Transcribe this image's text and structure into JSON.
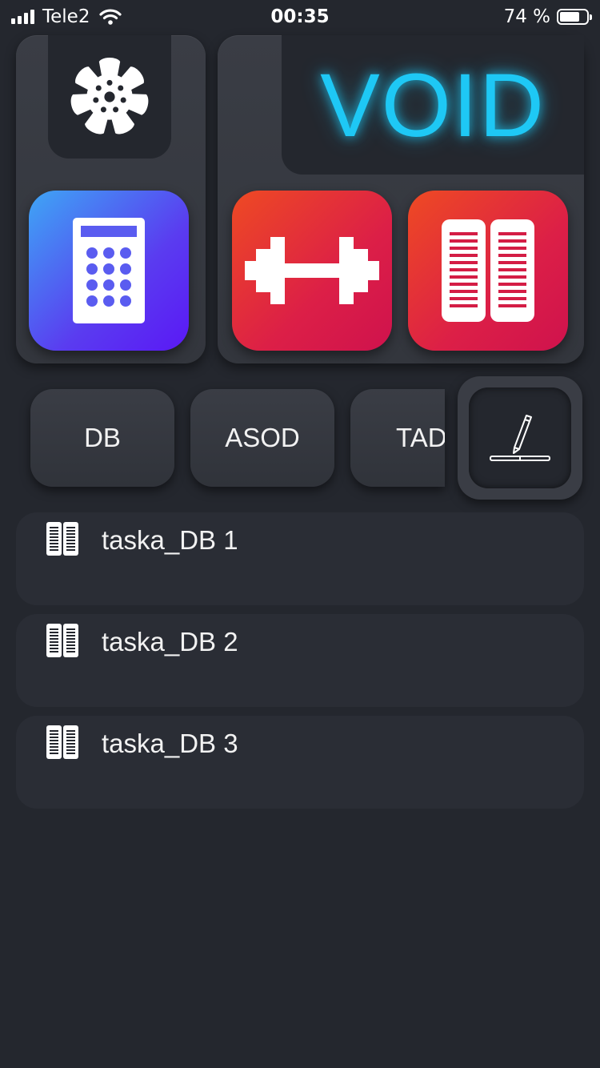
{
  "status_bar": {
    "carrier": "Tele2",
    "time": "00:35",
    "battery": "74 %",
    "battery_level": 0.74
  },
  "header": {
    "title": "VOID"
  },
  "apps": [
    {
      "name": "settings",
      "icon": "gear-icon"
    },
    {
      "name": "calculator",
      "icon": "calculator-icon",
      "colors": [
        "#3ea6f5",
        "#5a18f5"
      ]
    },
    {
      "name": "workout",
      "icon": "dumbbell-icon",
      "colors": [
        "#ee4a23",
        "#cf124d"
      ]
    },
    {
      "name": "notes",
      "icon": "book-icon",
      "colors": [
        "#ee4a23",
        "#cf124d"
      ]
    }
  ],
  "tabs": [
    {
      "label": "DB"
    },
    {
      "label": "ASOD"
    },
    {
      "label": "TAD"
    }
  ],
  "edit_button": {
    "icon": "pencil-icon"
  },
  "list": [
    {
      "label": "taska_DB 1",
      "icon": "book-icon"
    },
    {
      "label": "taska_DB 2",
      "icon": "book-icon"
    },
    {
      "label": "taska_DB 3",
      "icon": "book-icon"
    }
  ],
  "colors": {
    "background": "#24272e",
    "panel": "#3a3d45",
    "accent": "#1ec8f5"
  }
}
